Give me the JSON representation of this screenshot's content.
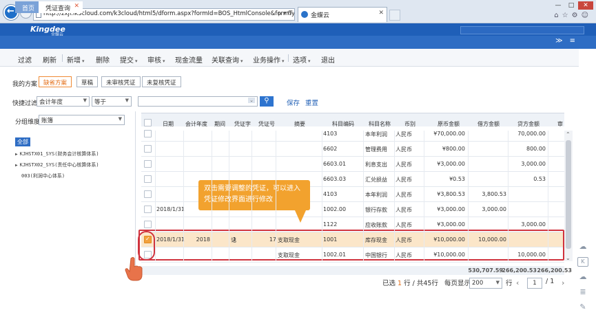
{
  "browser": {
    "url": "http://zxjf.ik3cloud.com/k3cloud/html5/dform.aspx?formId=BOS_HtmlConsole&formType=",
    "url_tools": "ρ ▾ ↻",
    "tab_title": "金蝶云",
    "window_controls": [
      "—",
      "□",
      "✕"
    ]
  },
  "app": {
    "logo": "Kingdee",
    "logo_sub": "金蝶云",
    "tabs": [
      {
        "label": "首页"
      },
      {
        "label": "凭证查询"
      }
    ],
    "tab_close": "✕"
  },
  "toolbar": {
    "items": [
      {
        "label": "过滤"
      },
      {
        "label": "刷新"
      },
      {
        "label": "新增",
        "dropdown": true
      },
      {
        "label": "删除"
      },
      {
        "label": "提交",
        "dropdown": true
      },
      {
        "label": "审核",
        "dropdown": true
      },
      {
        "label": "现金流量"
      },
      {
        "label": "关联查询",
        "dropdown": true
      },
      {
        "label": "业务操作",
        "dropdown": true
      },
      {
        "label": "选项",
        "dropdown": true
      },
      {
        "label": "退出"
      }
    ]
  },
  "scheme": {
    "label": "我的方案",
    "buttons": [
      "缺省方案",
      "草稿",
      "未审核凭证",
      "未复核凭证"
    ]
  },
  "filter": {
    "label": "快捷过滤",
    "field": "会计年度",
    "operator": "等于",
    "value": "",
    "save": "保存",
    "reset": "重置"
  },
  "dimension": {
    "label": "分组维度",
    "value": "账簿"
  },
  "tree": {
    "root": "全部",
    "items": [
      "KJHSTX01_SYS(财务会计核算体系)",
      "KJHSTX02_SYS(责任中心核算体系)",
      "003(利润中心体系)"
    ]
  },
  "grid": {
    "columns": [
      "日期",
      "会计年度",
      "期间",
      "凭证字",
      "凭证号",
      "摘要",
      "科目编码",
      "科目名称",
      "币别",
      "原币金额",
      "借方金额",
      "贷方金额",
      "审"
    ],
    "rows": [
      {
        "checked": false,
        "date": "",
        "year": "",
        "period": "",
        "word": "",
        "no": "",
        "summary": "",
        "code": "4103",
        "name": "本年利润",
        "currency": "人民币",
        "orig": "¥70,000.00",
        "debit": "",
        "credit": "70,000.00"
      },
      {
        "checked": false,
        "date": "",
        "year": "",
        "period": "",
        "word": "",
        "no": "",
        "summary": "",
        "code": "6602",
        "name": "管理费用",
        "currency": "人民币",
        "orig": "¥800.00",
        "debit": "",
        "credit": "800.00"
      },
      {
        "checked": false,
        "date": "",
        "year": "",
        "period": "",
        "word": "",
        "no": "",
        "summary": "",
        "code": "6603.01",
        "name": "利息支出",
        "currency": "人民币",
        "orig": "¥3,000.00",
        "debit": "",
        "credit": "3,000.00"
      },
      {
        "checked": false,
        "date": "",
        "year": "",
        "period": "",
        "word": "",
        "no": "",
        "summary": "",
        "code": "6603.03",
        "name": "汇兑损益",
        "currency": "人民币",
        "orig": "¥0.53",
        "debit": "",
        "credit": "0.53"
      },
      {
        "checked": false,
        "date": "",
        "year": "",
        "period": "",
        "word": "",
        "no": "",
        "summary": "",
        "code": "4103",
        "name": "本年利润",
        "currency": "人民币",
        "orig": "¥3,800.53",
        "debit": "3,800.53",
        "credit": ""
      },
      {
        "checked": false,
        "date": "2018/1/31",
        "year": "",
        "period": "",
        "word": "",
        "no": "",
        "summary": "",
        "code": "1002.00",
        "name": "银行存款",
        "currency": "人民币",
        "orig": "¥3,000.00",
        "debit": "3,000.00",
        "credit": ""
      },
      {
        "checked": false,
        "date": "",
        "year": "",
        "period": "",
        "word": "",
        "no": "",
        "summary": "",
        "code": "1122",
        "name": "应收账款",
        "currency": "人民币",
        "orig": "¥3,000.00",
        "debit": "",
        "credit": "3,000.00"
      },
      {
        "checked": true,
        "date": "2018/1/31",
        "year": "2018",
        "period": "1",
        "word": "记",
        "no": "17",
        "summary": "支取现金",
        "code": "1001",
        "name": "库存现金",
        "currency": "人民币",
        "orig": "¥10,000.00",
        "debit": "10,000.00",
        "credit": ""
      },
      {
        "checked": false,
        "date": "",
        "year": "",
        "period": "",
        "word": "",
        "no": "",
        "summary": "支取现金",
        "code": "1002.01",
        "name": "中国银行",
        "currency": "人民币",
        "orig": "¥10,000.00",
        "debit": "",
        "credit": "10,000.00"
      }
    ],
    "totals": {
      "orig": "530,707.59",
      "debit": "266,200.53",
      "credit": "266,200.53"
    }
  },
  "callout": {
    "text": "双击需要调整的凭证，可以进入凭证修改界面进行修改"
  },
  "pager": {
    "selected_prefix": "已选",
    "selected_count": "1",
    "selected_suffix": "行 / 共45行",
    "page_size_label": "每页显示",
    "page_size": "200",
    "row_label": "行",
    "current_page": "1",
    "total_pages": "/ 1"
  }
}
